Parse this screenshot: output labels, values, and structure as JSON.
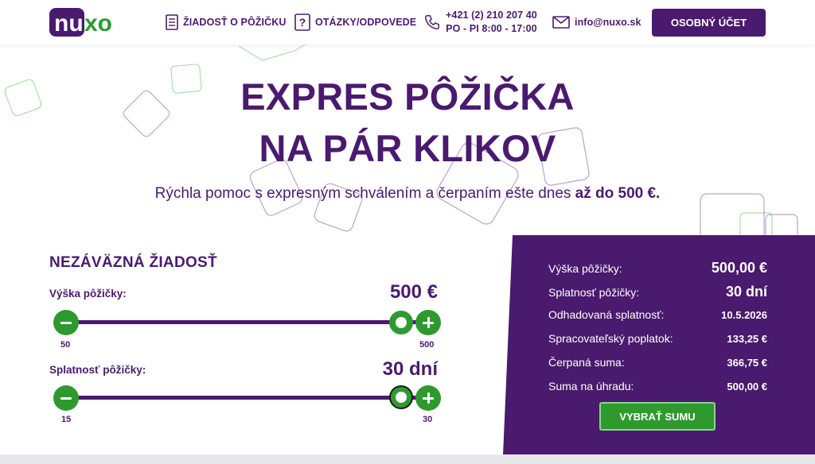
{
  "brand": {
    "logo_text": "nuxo",
    "accent": "#4a1a6e",
    "green": "#2e9a2e"
  },
  "nav": {
    "loan_request": "ŽIADOSŤ O PÔŽIČKU",
    "faq": "OTÁZKY/ODPOVEDE",
    "phone": "+421 (2) 210 207 40",
    "hours": "PO - PI 8:00 - 17:00",
    "email": "info@nuxo.sk",
    "account_button": "OSOBNÝ ÚČET"
  },
  "hero": {
    "title_line1": "EXPRES PÔŽIČKA",
    "title_line2": "NA PÁR KLIKOV",
    "subtitle_part1": "Rýchla pomoc s expresným schválením a čerpaním ešte dnes ",
    "subtitle_part2": "až do 500 €."
  },
  "form": {
    "title": "NEZÁVÄZNÁ ŽIADOSŤ",
    "amount": {
      "label": "Výška pôžičky:",
      "value": "500 €",
      "min": "50",
      "max": "500",
      "level": 1.0
    },
    "term": {
      "label": "Splatnosť pôžičky:",
      "value": "30 dní",
      "min": "15",
      "max": "30",
      "level": 1.0
    }
  },
  "summary": {
    "rows": [
      {
        "label": "Výška pôžičky:",
        "value": "500,00 €"
      },
      {
        "label": "Splatnosť pôžičky:",
        "value": "30 dní"
      },
      {
        "label": "Odhadovaná splatnosť:",
        "value": "10.5.2026"
      },
      {
        "label": "Spracovateľský poplatok:",
        "value": "133,25 €"
      },
      {
        "label": "Čerpaná suma:",
        "value": "366,75 €"
      },
      {
        "label": "Suma na úhradu:",
        "value": "500,00 €"
      }
    ],
    "button": "VYBRAŤ SUMU"
  }
}
